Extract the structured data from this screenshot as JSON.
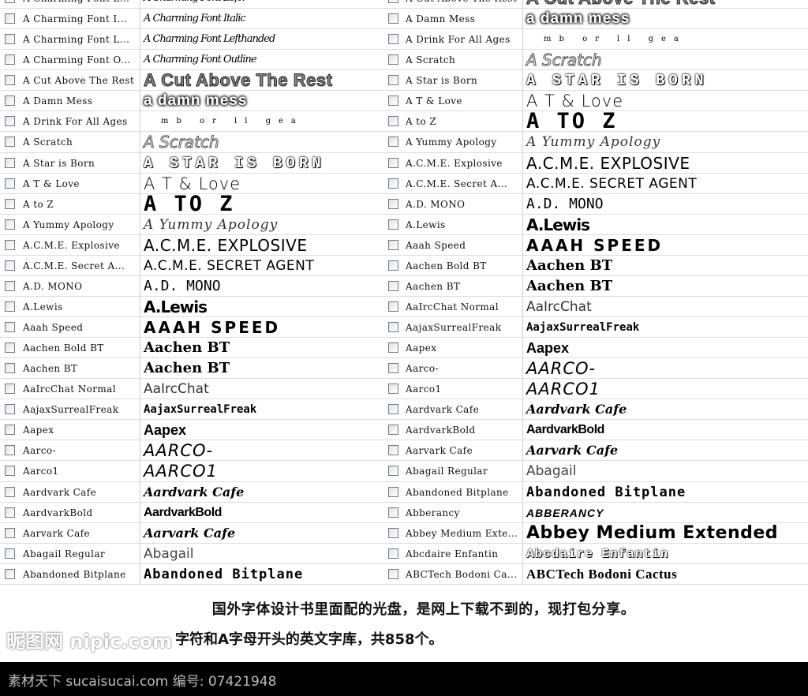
{
  "font_list": {
    "left": [
      {
        "name": "A Charming Font L...",
        "sample": "A Charming Font Leftv",
        "style": "s-script",
        "checked": false
      },
      {
        "name": "A Charming Font I...",
        "sample": "A Charming Font Italic",
        "style": "s-script",
        "checked": false
      },
      {
        "name": "A Charming Font L...",
        "sample": "A Charming Font Lefthanded",
        "style": "s-script",
        "checked": false
      },
      {
        "name": "A Charming Font O...",
        "sample": "A Charming Font Outline",
        "style": "s-script",
        "checked": false
      },
      {
        "name": "A Cut Above The Rest",
        "sample": "A Cut Above The Rest",
        "style": "s-heavy",
        "checked": false
      },
      {
        "name": "A Damn Mess",
        "sample": "a damn mess",
        "style": "s-blot",
        "checked": false
      },
      {
        "name": "A Drink For All Ages",
        "sample": "mb  or  ll  gea",
        "style": "s-tiny",
        "checked": false
      },
      {
        "name": "A Scratch",
        "sample": "A Scratch",
        "style": "s-outline",
        "checked": false
      },
      {
        "name": "A Star is Born",
        "sample": "A STAR IS BORN",
        "style": "s-stamp",
        "checked": false
      },
      {
        "name": "A T  & Love",
        "sample": "A T & Love",
        "style": "s-thin",
        "checked": false
      },
      {
        "name": "A to Z",
        "sample": "A TO Z",
        "style": "s-pixel",
        "checked": false
      },
      {
        "name": "A Yummy Apology",
        "sample": "A Yummy Apology",
        "style": "s-italic-script",
        "checked": false
      },
      {
        "name": "A.C.M.E. Explosive",
        "sample": "A.C.M.E. EXPLOSIVE",
        "style": "s-comic",
        "checked": false
      },
      {
        "name": "A.C.M.E. Secret A...",
        "sample": "A.C.M.E. SECRET AGENT",
        "style": "s-comic-sm",
        "checked": false
      },
      {
        "name": "A.D. MONO",
        "sample": "A.D. MONO",
        "style": "s-mono-thin",
        "checked": false
      },
      {
        "name": "A.Lewis",
        "sample": "A.Lewis",
        "style": "s-brush",
        "checked": false
      },
      {
        "name": "Aaah Speed",
        "sample": "AAAH SPEED",
        "style": "s-wide",
        "checked": false
      },
      {
        "name": "Aachen Bold BT",
        "sample": "Aachen BT",
        "style": "s-slab",
        "checked": false
      },
      {
        "name": "Aachen BT",
        "sample": "Aachen BT",
        "style": "s-slab",
        "checked": false
      },
      {
        "name": "AaIrcChat Normal",
        "sample": "AaIrcChat",
        "style": "s-plain",
        "checked": false
      },
      {
        "name": "AajaxSurrealFreak",
        "sample": "AajaxSurrealFreak",
        "style": "s-freak",
        "checked": false
      },
      {
        "name": "Aapex",
        "sample": "Aapex",
        "style": "s-bold-sans",
        "checked": false
      },
      {
        "name": "Aarco-",
        "sample": "AARCO-",
        "style": "s-scratchy",
        "checked": false
      },
      {
        "name": "Aarco1",
        "sample": "AARCO1",
        "style": "s-scratchy",
        "checked": false
      },
      {
        "name": "Aardvark Cafe",
        "sample": "Aardvark Cafe",
        "style": "s-bold-italic",
        "checked": false
      },
      {
        "name": "AardvarkBold",
        "sample": "AardvarkBold",
        "style": "s-condensed",
        "checked": false
      },
      {
        "name": "Aarvark Cafe",
        "sample": "Aarvark Cafe",
        "style": "s-bold-italic",
        "checked": false
      },
      {
        "name": "Abagail Regular",
        "sample": "Abagail",
        "style": "s-handwrite",
        "checked": false
      },
      {
        "name": "Abandoned Bitplane",
        "sample": "Abandoned Bitplane",
        "style": "s-bitplane",
        "checked": false
      }
    ],
    "right": [
      {
        "name": "A Cut Above The Rest",
        "sample": "A Cut Above The Rest",
        "style": "s-heavy",
        "checked": false
      },
      {
        "name": "A Damn Mess",
        "sample": "a damn mess",
        "style": "s-blot",
        "checked": false
      },
      {
        "name": "A Drink For All Ages",
        "sample": "mb  or  ll  gea",
        "style": "s-tiny",
        "checked": false
      },
      {
        "name": "A Scratch",
        "sample": "A Scratch",
        "style": "s-outline",
        "checked": false
      },
      {
        "name": "A Star is Born",
        "sample": "A STAR IS BORN",
        "style": "s-stamp",
        "checked": false
      },
      {
        "name": "A T  & Love",
        "sample": "A T & Love",
        "style": "s-thin",
        "checked": false
      },
      {
        "name": "A to Z",
        "sample": "A TO Z",
        "style": "s-pixel",
        "checked": false
      },
      {
        "name": "A Yummy Apology",
        "sample": "A Yummy Apology",
        "style": "s-italic-script",
        "checked": false
      },
      {
        "name": "A.C.M.E. Explosive",
        "sample": "A.C.M.E. EXPLOSIVE",
        "style": "s-comic",
        "checked": false
      },
      {
        "name": "A.C.M.E. Secret A...",
        "sample": "A.C.M.E. SECRET AGENT",
        "style": "s-comic-sm",
        "checked": false
      },
      {
        "name": "A.D. MONO",
        "sample": "A.D. MONO",
        "style": "s-mono-thin",
        "checked": false
      },
      {
        "name": "A.Lewis",
        "sample": "A.Lewis",
        "style": "s-brush",
        "checked": false
      },
      {
        "name": "Aaah Speed",
        "sample": "AAAH SPEED",
        "style": "s-wide",
        "checked": false
      },
      {
        "name": "Aachen Bold BT",
        "sample": "Aachen BT",
        "style": "s-slab",
        "checked": false
      },
      {
        "name": "Aachen BT",
        "sample": "Aachen BT",
        "style": "s-slab",
        "checked": false
      },
      {
        "name": "AaIrcChat Normal",
        "sample": "AaIrcChat",
        "style": "s-plain",
        "checked": false
      },
      {
        "name": "AajaxSurrealFreak",
        "sample": "AajaxSurrealFreak",
        "style": "s-freak",
        "checked": false
      },
      {
        "name": "Aapex",
        "sample": "Aapex",
        "style": "s-bold-sans",
        "checked": false
      },
      {
        "name": "Aarco-",
        "sample": "AARCO-",
        "style": "s-scratchy",
        "checked": false
      },
      {
        "name": "Aarco1",
        "sample": "AARCO1",
        "style": "s-scratchy",
        "checked": false
      },
      {
        "name": "Aardvark Cafe",
        "sample": "Aardvark Cafe",
        "style": "s-bold-italic",
        "checked": false
      },
      {
        "name": "AardvarkBold",
        "sample": "AardvarkBold",
        "style": "s-condensed",
        "checked": false
      },
      {
        "name": "Aarvark Cafe",
        "sample": "Aarvark Cafe",
        "style": "s-bold-italic",
        "checked": false
      },
      {
        "name": "Abagail Regular",
        "sample": "Abagail",
        "style": "s-handwrite",
        "checked": false
      },
      {
        "name": "Abandoned Bitplane",
        "sample": "Abandoned Bitplane",
        "style": "s-bitplane",
        "checked": false
      },
      {
        "name": "Abberancy",
        "sample": "ABBERANCY",
        "style": "s-aberr",
        "checked": false
      },
      {
        "name": "Abbey Medium Exte...",
        "sample": "Abbey Medium Extended",
        "style": "s-abbey",
        "checked": false
      },
      {
        "name": "Abcdaire Enfantin",
        "sample": "Abcdaire Enfantin",
        "style": "s-abcdaire",
        "checked": false
      },
      {
        "name": "ABCTech Bodoni Ca...",
        "sample": "ABCTech Bodoni Cactus",
        "style": "s-bodoni",
        "checked": false
      }
    ]
  },
  "captions": {
    "line1": "国外字体设计书里面配的光盘，是网上下载不到的，现打包分享。",
    "line2": "字符和A字母开头的英文字库，共858个。"
  },
  "watermark": "昵图网 nipic.com",
  "footer": {
    "text": "素材天下 sucaisucai.com  编号: 07421948"
  }
}
